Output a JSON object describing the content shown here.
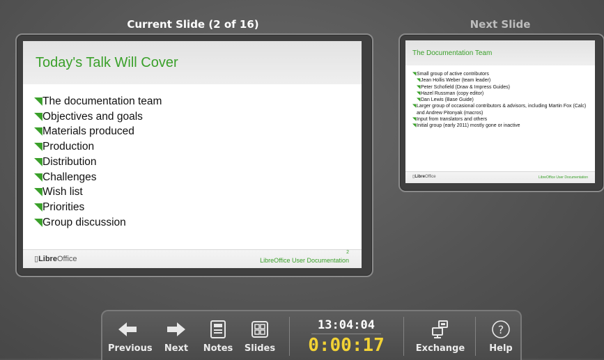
{
  "current": {
    "heading": "Current Slide (2 of 16)",
    "slide": {
      "title": "Today's Talk Will Cover",
      "bullets": [
        "The documentation team",
        "Objectives and goals",
        "Materials produced",
        "Production",
        "Distribution",
        "Challenges",
        "Wish list",
        "Priorities",
        "Group discussion"
      ],
      "logo_bold": "Libre",
      "logo_rest": "Office",
      "footer": "LibreOffice User Documentation",
      "page_number": "2"
    }
  },
  "next": {
    "heading": "Next Slide",
    "slide": {
      "title": "The Documentation Team",
      "bullets": [
        {
          "text": "Small group of active contributors",
          "level": 1
        },
        {
          "text": "Jean Hollis Weber (team leader)",
          "level": 2
        },
        {
          "text": "Peter Schofield (Draw & Impress Guides)",
          "level": 2
        },
        {
          "text": "Hazel Russman (copy editor)",
          "level": 2
        },
        {
          "text": "Dan Lewis (Base Guide)",
          "level": 2
        },
        {
          "text": "Larger group of occasional contributors & advisors, including Martin Fox (Calc) and Andrew Pitonyak (macros)",
          "level": 1
        },
        {
          "text": "Input from translators and others",
          "level": 1
        },
        {
          "text": "Initial group (early 2011) mostly gone or inactive",
          "level": 1
        }
      ],
      "logo_bold": "Libre",
      "logo_rest": "Office",
      "footer": "LibreOffice User Documentation"
    }
  },
  "toolbar": {
    "previous_label": "Previous",
    "next_label": "Next",
    "notes_label": "Notes",
    "slides_label": "Slides",
    "clock_time": "13:04:04",
    "elapsed_time": "0:00:17",
    "exchange_label": "Exchange",
    "help_label": "Help"
  },
  "colors": {
    "accent_green": "#3aa02a",
    "timer_yellow": "#f2d235"
  }
}
